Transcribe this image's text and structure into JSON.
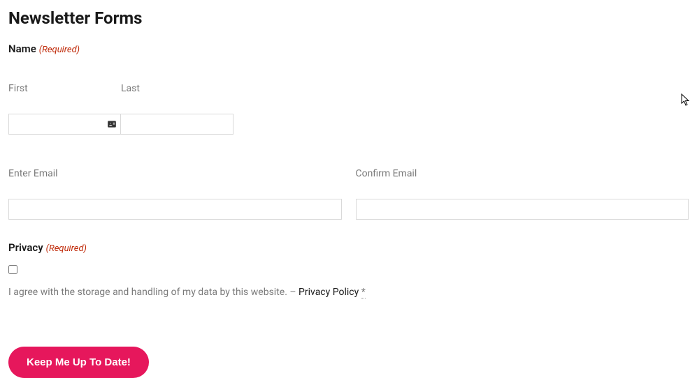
{
  "page_title": "Newsletter Forms",
  "name": {
    "label": "Name",
    "required_text": "(Required)",
    "first_label": "First",
    "last_label": "Last",
    "first_value": "",
    "last_value": ""
  },
  "email": {
    "enter_label": "Enter Email",
    "confirm_label": "Confirm Email",
    "enter_value": "",
    "confirm_value": ""
  },
  "privacy": {
    "label": "Privacy",
    "required_text": "(Required)",
    "checkbox_checked": false,
    "consent_text_pre": "I agree with the storage and handling of my data by this website. – ",
    "link_text": "Privacy Policy",
    "asterisk": "*"
  },
  "submit": {
    "label": "Keep Me Up To Date!"
  }
}
